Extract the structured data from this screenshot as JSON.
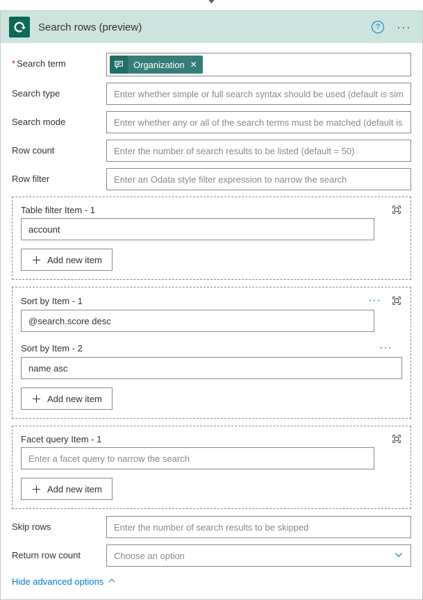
{
  "header": {
    "title": "Search rows (preview)"
  },
  "fields": {
    "search_term": {
      "label": "Search term",
      "token_label": "Organization"
    },
    "search_type": {
      "label": "Search type",
      "placeholder": "Enter whether simple or full search syntax should be used (default is simple)"
    },
    "search_mode": {
      "label": "Search mode",
      "placeholder": "Enter whether any or all of the search terms must be matched (default is any)"
    },
    "row_count": {
      "label": "Row count",
      "placeholder": "Enter the number of search results to be listed (default = 50)"
    },
    "row_filter": {
      "label": "Row filter",
      "placeholder": "Enter an Odata style filter expression to narrow the search"
    },
    "skip_rows": {
      "label": "Skip rows",
      "placeholder": "Enter the number of search results to be skipped"
    },
    "return_row_count": {
      "label": "Return row count",
      "placeholder": "Choose an option"
    }
  },
  "groups": {
    "table_filter": {
      "item1_label": "Table filter Item - 1",
      "item1_value": "account"
    },
    "sort_by": {
      "item1_label": "Sort by Item - 1",
      "item1_value": "@search.score desc",
      "item2_label": "Sort by Item - 2",
      "item2_value": "name asc"
    },
    "facet_query": {
      "item1_label": "Facet query Item - 1",
      "item1_placeholder": "Enter a facet query to narrow the search"
    }
  },
  "buttons": {
    "add_new_item": "Add new item"
  },
  "links": {
    "hide_advanced": "Hide advanced options"
  }
}
